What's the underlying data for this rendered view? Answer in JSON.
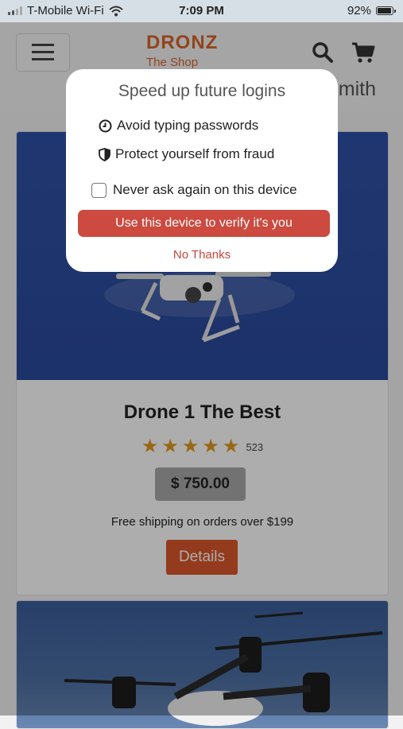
{
  "status_bar": {
    "carrier": "T-Mobile Wi-Fi",
    "time": "7:09 PM",
    "battery": "92%",
    "battery_level": 0.92,
    "signal_bars": 2
  },
  "header": {
    "brand": "DRONZ",
    "tagline": "The Shop",
    "user_name_partial": "mith",
    "icons": [
      "menu-icon",
      "search-icon",
      "cart-icon"
    ]
  },
  "products": [
    {
      "title": "Drone 1 The Best",
      "rating_stars": 5,
      "rating_count": "523",
      "price": "$ 750.00",
      "shipping": "Free shipping on orders over $199",
      "details_label": "Details"
    }
  ],
  "dialog": {
    "title": "Speed up future logins",
    "benefits": [
      {
        "icon": "clock-icon",
        "text": "Avoid typing passwords"
      },
      {
        "icon": "shield-icon",
        "text": "Protect yourself from fraud"
      }
    ],
    "never_ask_label": "Never ask again on this device",
    "never_ask_checked": false,
    "verify_label": "Use this device to verify it's you",
    "no_thanks_label": "No Thanks"
  },
  "colors": {
    "brand": "#d9632a",
    "verify_button": "#cc4a3f",
    "details_button": "#d9582a",
    "star": "#e09a1c"
  }
}
